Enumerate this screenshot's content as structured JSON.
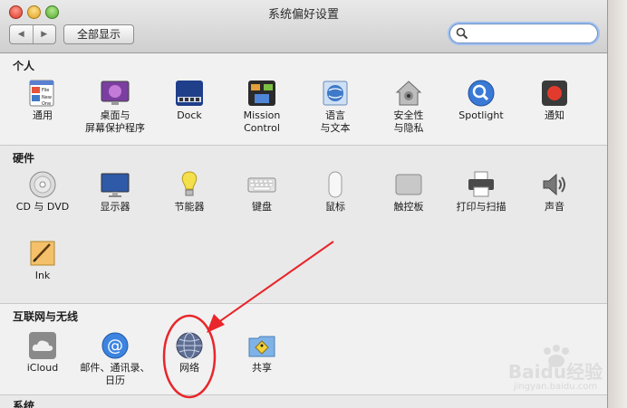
{
  "window": {
    "title": "系统偏好设置"
  },
  "toolbar": {
    "back_label": "◀",
    "forward_label": "▶",
    "show_all_label": "全部显示",
    "search_placeholder": ""
  },
  "sections": [
    {
      "title": "个人",
      "items": [
        {
          "label1": "通用",
          "label2": ""
        },
        {
          "label1": "桌面与",
          "label2": "屏幕保护程序"
        },
        {
          "label1": "Dock",
          "label2": ""
        },
        {
          "label1": "Mission",
          "label2": "Control"
        },
        {
          "label1": "语言",
          "label2": "与文本"
        },
        {
          "label1": "安全性",
          "label2": "与隐私"
        },
        {
          "label1": "Spotlight",
          "label2": ""
        },
        {
          "label1": "通知",
          "label2": ""
        }
      ]
    },
    {
      "title": "硬件",
      "items": [
        {
          "label1": "CD 与 DVD",
          "label2": ""
        },
        {
          "label1": "显示器",
          "label2": ""
        },
        {
          "label1": "节能器",
          "label2": ""
        },
        {
          "label1": "键盘",
          "label2": ""
        },
        {
          "label1": "鼠标",
          "label2": ""
        },
        {
          "label1": "触控板",
          "label2": ""
        },
        {
          "label1": "打印与扫描",
          "label2": ""
        },
        {
          "label1": "声音",
          "label2": ""
        },
        {
          "label1": "Ink",
          "label2": ""
        }
      ]
    },
    {
      "title": "互联网与无线",
      "items": [
        {
          "label1": "iCloud",
          "label2": ""
        },
        {
          "label1": "邮件、通讯录、",
          "label2": "日历"
        },
        {
          "label1": "网络",
          "label2": ""
        },
        {
          "label1": "共享",
          "label2": ""
        }
      ]
    },
    {
      "title": "系统",
      "items": []
    }
  ],
  "icon_text": {
    "general_file": "File",
    "general_new": "New",
    "general_one": "One"
  },
  "watermark": {
    "brand": "Baidu经验",
    "site": "jingyan.baidu.com"
  },
  "colors": {
    "annotation": "#e8262b",
    "search_focus": "#9ec0ef"
  }
}
